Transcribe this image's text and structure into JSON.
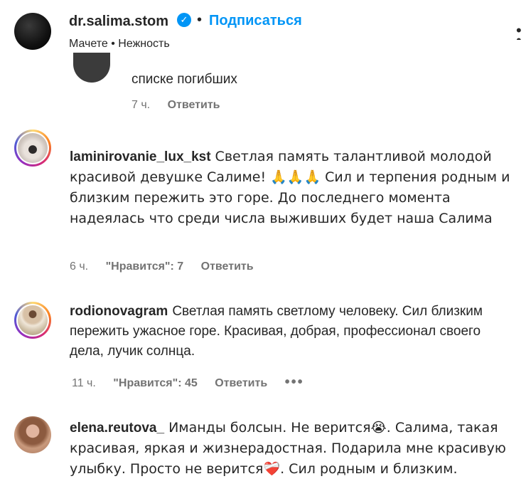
{
  "header": {
    "username": "dr.salima.stom",
    "separator": "•",
    "follow_label": "Подписаться",
    "subtitle": "Мачете • Нежность"
  },
  "previous_comment": {
    "text_tail": "списке погибших",
    "time": "7 ч.",
    "reply_label": "Ответить"
  },
  "comments": [
    {
      "username": "laminirovanie_lux_kst",
      "text": "Светлая память талантливой молодой красивой девушке Салиме! 🙏🙏🙏 Сил и терпения родным и близким пережить это горе. До последнего момента надеялась что среди числа выживших будет наша Салима",
      "time": "6 ч.",
      "likes_label": "\"Нравится\": 7",
      "reply_label": "Ответить"
    },
    {
      "username": "rodionovagram",
      "text": "Светлая память светлому человеку. Сил близким пережить ужасное горе. Красивая, добрая, профессионал своего дела, лучик солнца.",
      "time": "11 ч.",
      "likes_label": "\"Нравится\": 45",
      "reply_label": "Ответить",
      "more_label": "•••"
    },
    {
      "username": "elena.reutova_",
      "text": "Иманды болсын. Не верится😭. Салима, такая красивая, яркая и жизнерадостная. Подарила мне красивую улыбку. Просто не верится❤️‍🩹. Сил родным и близким."
    }
  ],
  "colors": {
    "accent": "#0095f6",
    "text": "#262626",
    "muted": "#737373"
  },
  "icons": {
    "verified": "verified-badge-icon",
    "more": "more-options-icon"
  }
}
